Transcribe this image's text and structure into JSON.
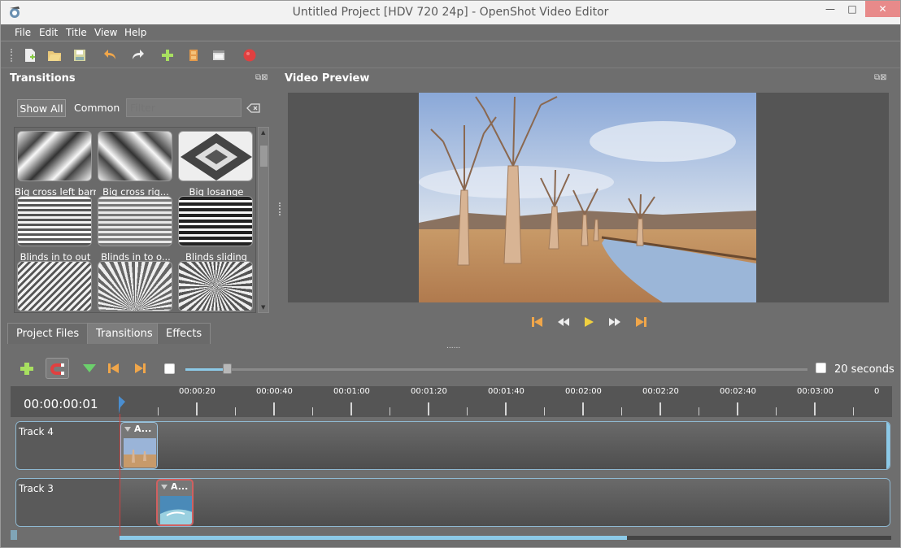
{
  "window": {
    "title": "Untitled Project [HDV 720 24p] - OpenShot Video Editor",
    "min_glyph": "—",
    "max_glyph": "□",
    "close_glyph": "✕"
  },
  "menu": [
    "File",
    "Edit",
    "Title",
    "View",
    "Help"
  ],
  "toolbar_icons": [
    "new-project-icon",
    "open-project-icon",
    "save-project-icon",
    "undo-icon",
    "redo-icon",
    "import-files-icon",
    "profile-icon",
    "fullscreen-icon",
    "export-video-icon"
  ],
  "transitions_panel": {
    "title": "Transitions",
    "show_all": "Show All",
    "common": "Common",
    "filter_placeholder": "Filter",
    "items": [
      {
        "label": "Big cross left barr"
      },
      {
        "label": "Big cross rig..."
      },
      {
        "label": "Big losange"
      },
      {
        "label": "Blinds in to out"
      },
      {
        "label": "Blinds in to o..."
      },
      {
        "label": "Blinds sliding"
      }
    ]
  },
  "tabs": [
    "Project Files",
    "Transitions",
    "Effects"
  ],
  "active_tab": "Transitions",
  "video_preview": {
    "title": "Video Preview"
  },
  "playback_controls": [
    "jump-start-icon",
    "rewind-icon",
    "play-icon",
    "fast-forward-icon",
    "jump-end-icon"
  ],
  "timeline": {
    "zoom_label": "20 seconds",
    "zoom_level": 0.07,
    "time_display": "00:00:00:01",
    "ruler_labels": [
      "00:00:20",
      "00:00:40",
      "00:01:00",
      "00:01:20",
      "00:01:40",
      "00:02:00",
      "00:02:20",
      "00:02:40",
      "00:03:00",
      "0"
    ],
    "tracks": [
      {
        "name": "Track 4",
        "clip_title": "A..."
      },
      {
        "name": "Track 3",
        "clip_title": "A..."
      }
    ],
    "scroll_fraction": 0.66
  },
  "colors": {
    "accent": "#8ccae8",
    "playhead": "#d04040",
    "close_button": "#e88a8a",
    "record": "#e04040"
  }
}
